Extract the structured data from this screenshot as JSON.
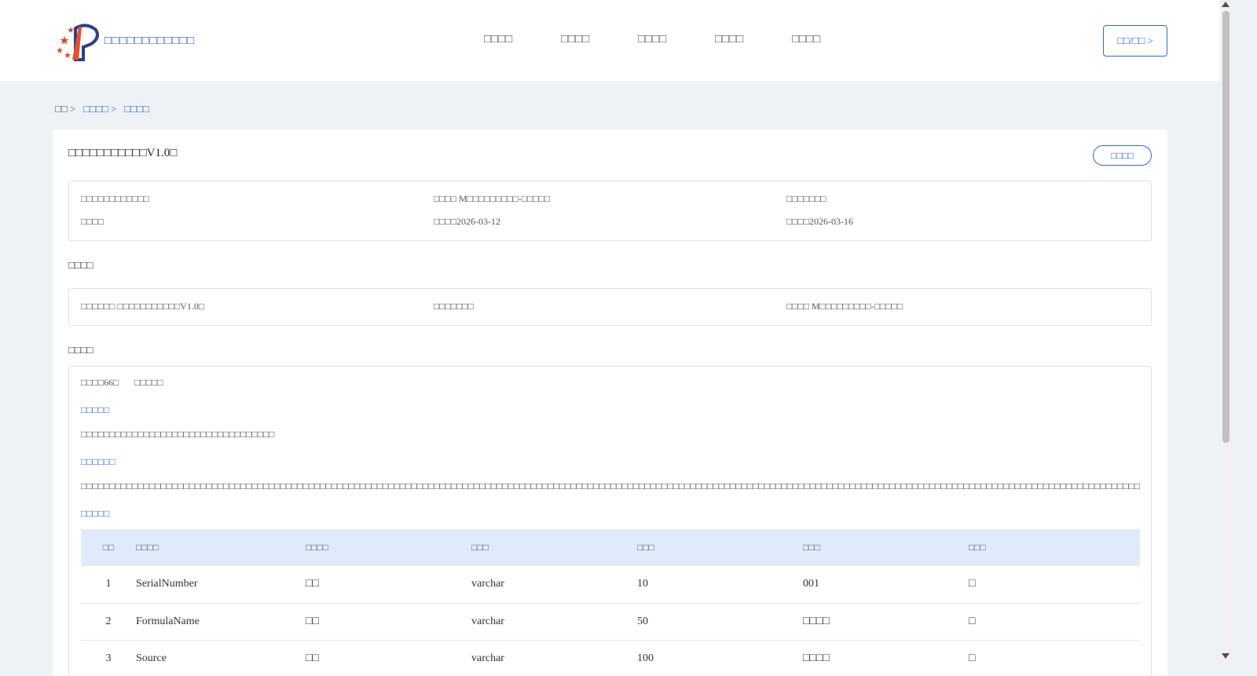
{
  "header": {
    "brand": "□□□□□□□□□□□□",
    "nav": [
      "□□□□",
      "□□□□",
      "□□□□",
      "□□□□",
      "□□□□"
    ],
    "login": "□□/□□ >"
  },
  "breadcrumb": {
    "home": "□□ >",
    "level2": "□□□□ >",
    "current": "□□□□"
  },
  "detail": {
    "title": "□□□□□□□□□□□V1.0□",
    "back": "□□□□",
    "meta": {
      "r1c1": "□□□□□□□□□□□□",
      "r1c2": "□□□□ M□□□□□□□□□-□□□□□",
      "r1c3": "□□□□□□□",
      "r2c1": "□□□□",
      "r2c2": "□□□□2026-03-12",
      "r2c3": "□□□□2026-03-16"
    },
    "section1": "□□□□",
    "resource": {
      "c1": "□□□□□□ □□□□□□□□□□□V1.0□",
      "c2": "□□□□□□□",
      "c3": "□□□□ M□□□□□□□□□-□□□□□"
    },
    "section2": "□□□□",
    "fields_meta": {
      "count": "□□□□66□",
      "extra": "□□□□□"
    },
    "sub1_title": "□□□□□",
    "sub1_text": "□□□□□□□□□□□□□□□□□□□□□□□□□□□□□□□□□□",
    "sub2_title": "□□□□□□",
    "sub2_text": "□□□□□□□□□□□□□□□□□□□□□□□□□□□□□□□□□□□□□□□□□□□□□□□□□□□□□□□□□□□□□□□□□□□□□□□□□□□□□□□□□□□□□□□□□□□□□□□□□□□□□□□□□□□□□□□□□□□□□□□□□□□□□□□□□□□□□□□□□□□□□□□□□□□□□□□□□□□□□□□□□□□□□□□□□□□□□□□□□□□□□□□□□□□□□□□□□□",
    "sub3_title": "□□□□□",
    "table": {
      "headers": [
        "□□",
        "□□□□",
        "□□□□",
        "□□□",
        "□□□",
        "□□□",
        "□□□"
      ],
      "rows": [
        [
          "1",
          "SerialNumber",
          "□□",
          "varchar",
          "10",
          "001",
          "□"
        ],
        [
          "2",
          "FormulaName",
          "□□",
          "varchar",
          "50",
          "□□□□",
          "□"
        ],
        [
          "3",
          "Source",
          "□□",
          "varchar",
          "100",
          "□□□□",
          "□"
        ]
      ]
    }
  }
}
